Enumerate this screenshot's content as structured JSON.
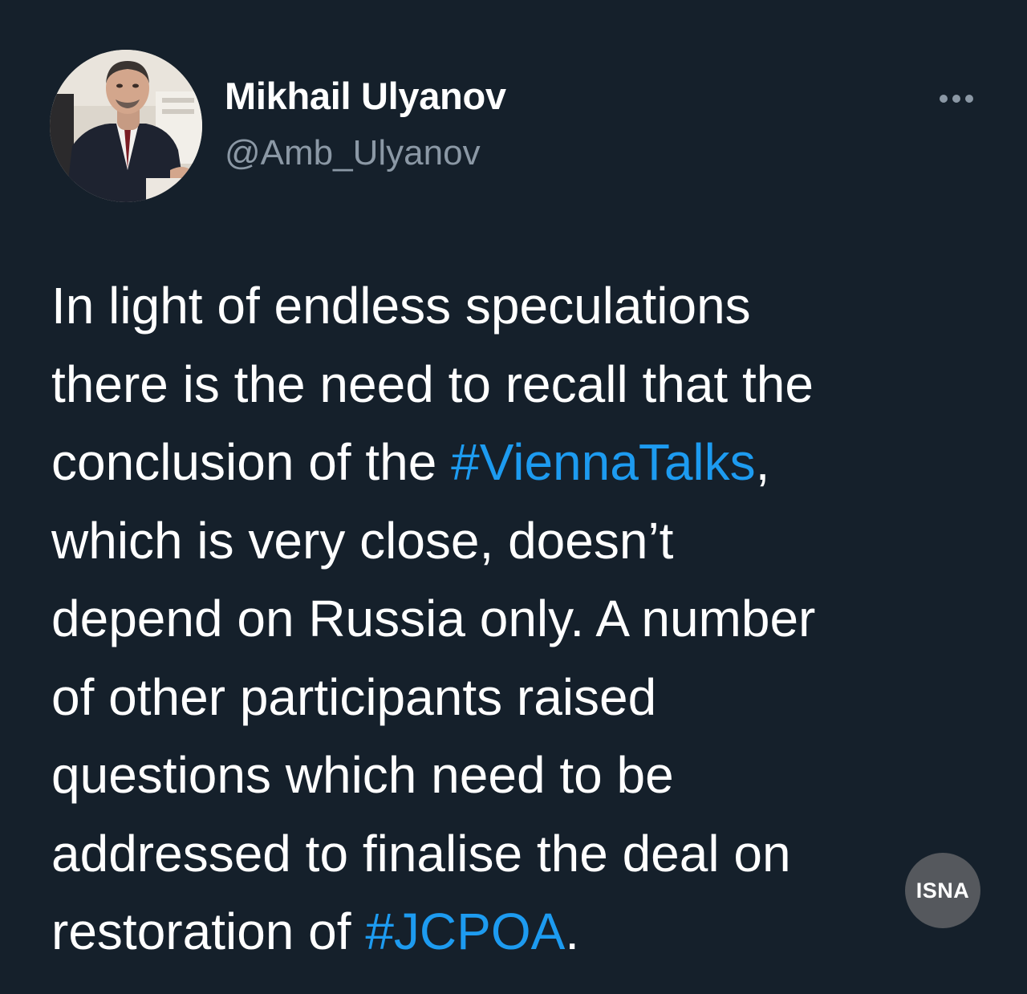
{
  "author": {
    "display_name": "Mikhail Ulyanov",
    "handle": "@Amb_Ulyanov",
    "avatar_icon": "profile-photo"
  },
  "more_icon": "more-horizontal-icon",
  "tweet_body": {
    "line1": "In light of endless speculations",
    "line2": "there is the need to recall that the",
    "line3_text": "conclusion of the ",
    "line3_hashtag": "#ViennaTalks",
    "line3_tail": ",",
    "line4": "which is very close, doesn’t",
    "line5": "depend on Russia only. A number",
    "line6": "of other participants raised",
    "line7": "questions which need to be",
    "line8": "addressed to finalise the deal on",
    "line9_text": "restoration of ",
    "line9_hashtag": "#JCPOA",
    "line9_tail": "."
  },
  "watermark": {
    "label": "ISNA"
  },
  "colors": {
    "background": "#15202b",
    "text": "#ffffff",
    "secondary_text": "#8b98a5",
    "hashtag": "#1d9bf0",
    "watermark_bg": "#55585d"
  }
}
